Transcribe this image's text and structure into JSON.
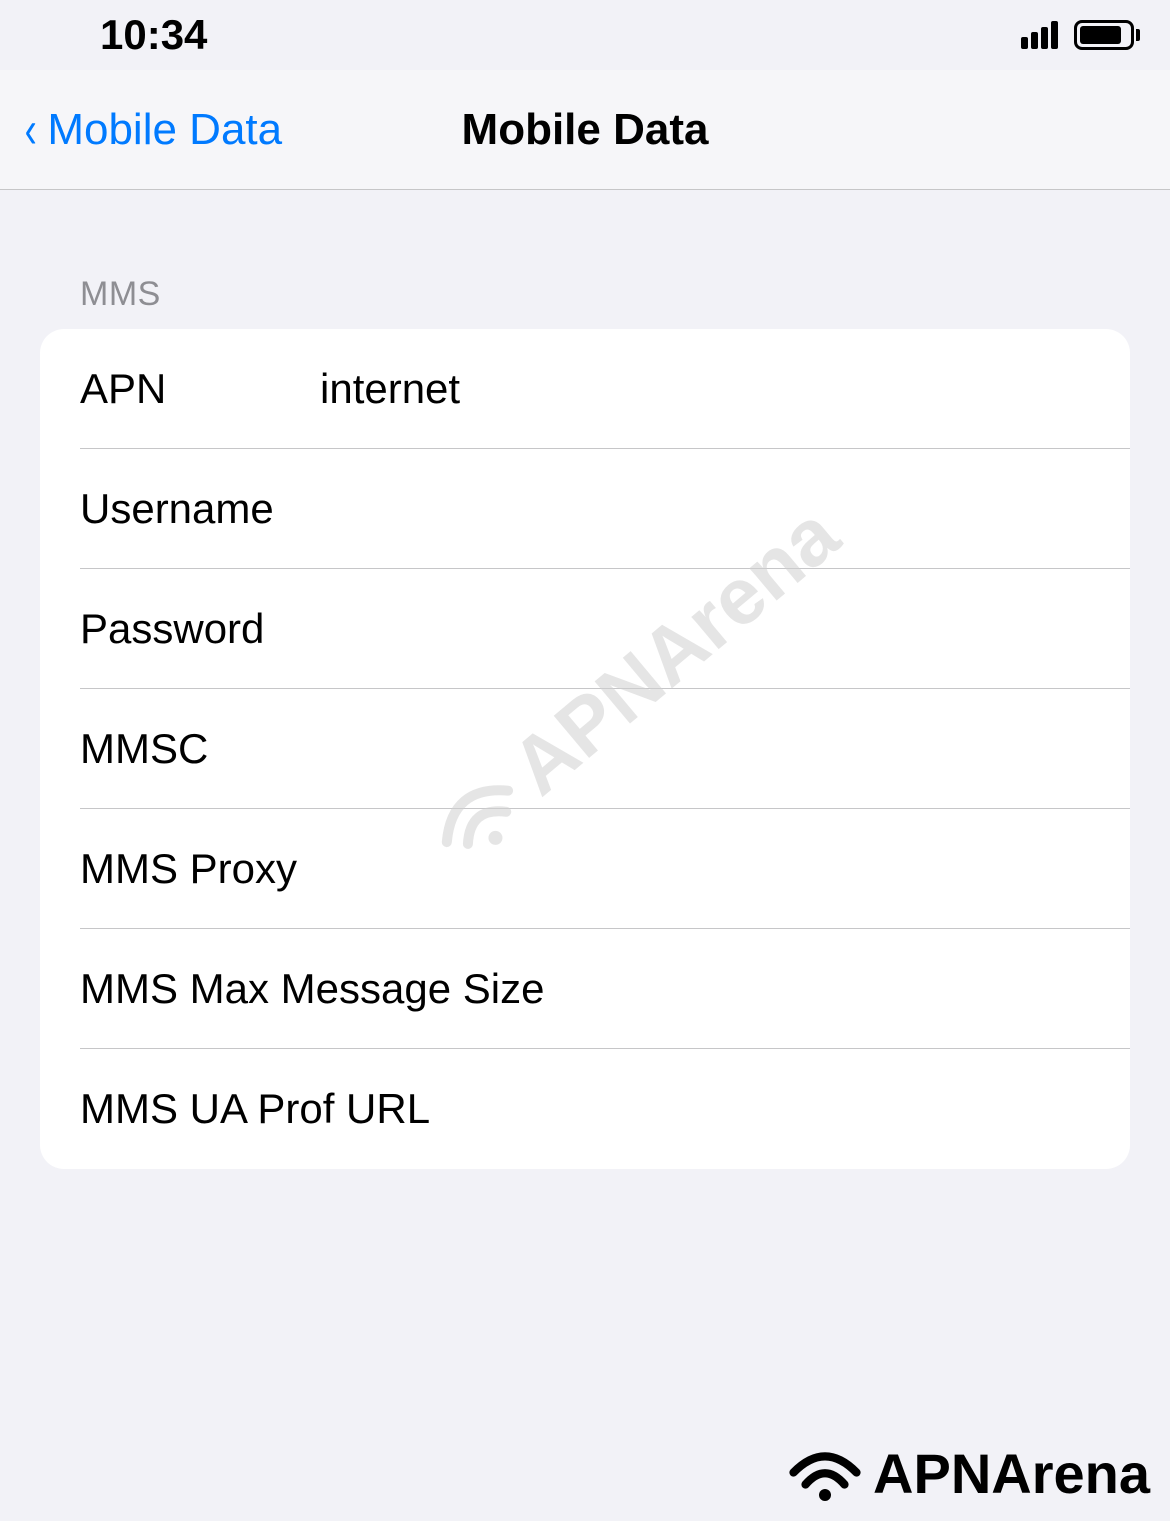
{
  "status_bar": {
    "time": "10:34"
  },
  "nav": {
    "back_label": "Mobile Data",
    "title": "Mobile Data"
  },
  "section": {
    "header": "MMS",
    "rows": [
      {
        "label": "APN",
        "value": "internet"
      },
      {
        "label": "Username",
        "value": ""
      },
      {
        "label": "Password",
        "value": ""
      },
      {
        "label": "MMSC",
        "value": ""
      },
      {
        "label": "MMS Proxy",
        "value": ""
      },
      {
        "label": "MMS Max Message Size",
        "value": ""
      },
      {
        "label": "MMS UA Prof URL",
        "value": ""
      }
    ]
  },
  "watermark": "APNArena",
  "footer": "APNArena"
}
